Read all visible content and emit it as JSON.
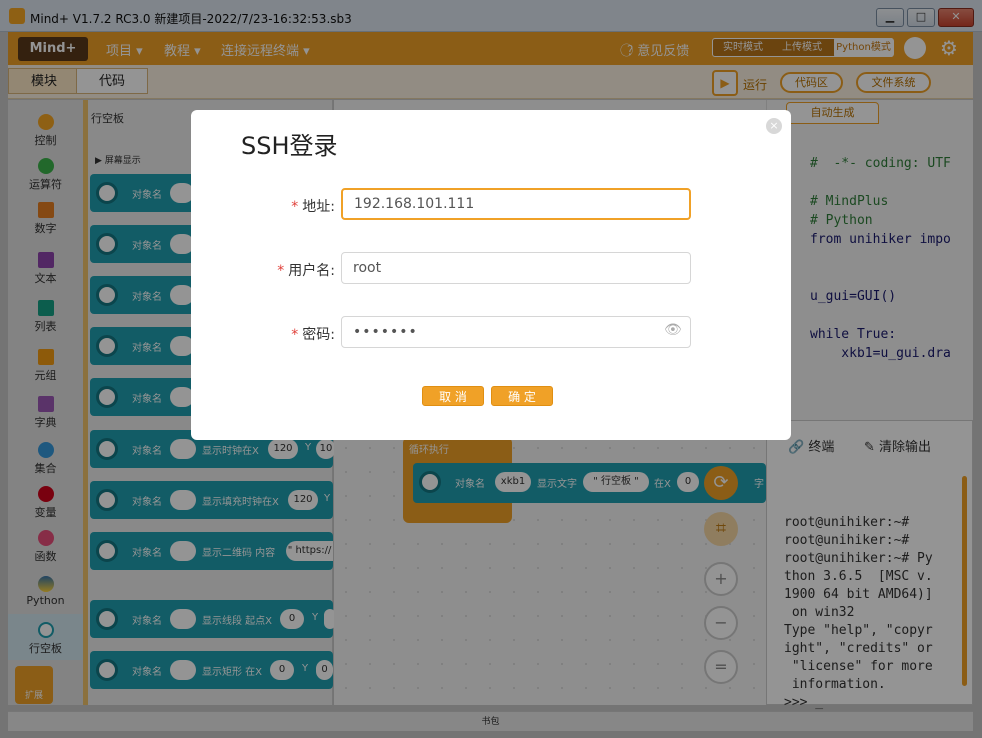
{
  "window": {
    "title": "Mind+ V1.7.2 RC3.0   新建项目-2022/7/23-16:32:53.sb3",
    "min": "▁",
    "max": "□",
    "close": "✕"
  },
  "appbar": {
    "logo": "Mind+",
    "menus": [
      "项目 ▾",
      "教程 ▾",
      "连接远程终端 ▾"
    ],
    "feedback": "意见反馈",
    "modes": [
      "实时模式",
      "上传模式",
      "Python模式"
    ]
  },
  "toolbar": {
    "tabs": [
      "模块",
      "代码"
    ],
    "run": "运行",
    "code_area": "代码区",
    "file_system": "文件系统"
  },
  "sidebar": [
    "控制",
    "运算符",
    "数字",
    "文本",
    "列表",
    "元组",
    "字典",
    "集合",
    "变量",
    "函数",
    "Python",
    "行空板",
    "扩展"
  ],
  "palette": {
    "title": "行空板",
    "section": "屏幕显示",
    "obj": "对象名",
    "rows": [
      {
        "text": "显示时钟在X",
        "a": "120",
        "b": "Y",
        "c": "10"
      },
      {
        "text": "显示填充时钟在X",
        "a": "120",
        "b": "Y",
        "c": ""
      },
      {
        "text": "显示二维码 内容",
        "a": "\" https://",
        "b": "",
        "c": ""
      },
      {
        "text": "显示线段 起点X",
        "a": "0",
        "b": "Y",
        "c": ""
      },
      {
        "text": "显示矩形 在X",
        "a": "0",
        "b": "Y",
        "c": "0"
      }
    ]
  },
  "workspace": {
    "loop": "循环执行",
    "obj": "对象名",
    "var": "xkb1",
    "text": "显示文字",
    "str": "\" 行空板 \"",
    "atx": "在X",
    "x": "0",
    "more": "字"
  },
  "code": {
    "tab": "自动生成",
    "lines": [
      "#  -*- coding: UTF",
      "",
      "# MindPlus",
      "# Python",
      "from unihiker impo",
      "",
      "",
      "u_gui=GUI()",
      "",
      "while True:",
      "    xkb1=u_gui.dra",
      ""
    ]
  },
  "terminal": {
    "tab": "终端",
    "clear": "清除输出",
    "lines": [
      "root@unihiker:~#",
      "root@unihiker:~#",
      "root@unihiker:~# Py",
      "thon 3.6.5  [MSC v.",
      "1900 64 bit AMD64)]",
      " on win32",
      "Type \"help\", \"copyr",
      "ight\", \"credits\" or",
      " \"license\" for more",
      " information.",
      ">>> _"
    ]
  },
  "bottom": "书包",
  "dialog": {
    "title": "SSH登录",
    "close": "×",
    "address_label": "地址:",
    "address": "192.168.101.111",
    "user_label": "用户名:",
    "user": "root",
    "pass_label": "密码:",
    "password": "•••••••",
    "cancel": "取 消",
    "ok": "确 定"
  }
}
